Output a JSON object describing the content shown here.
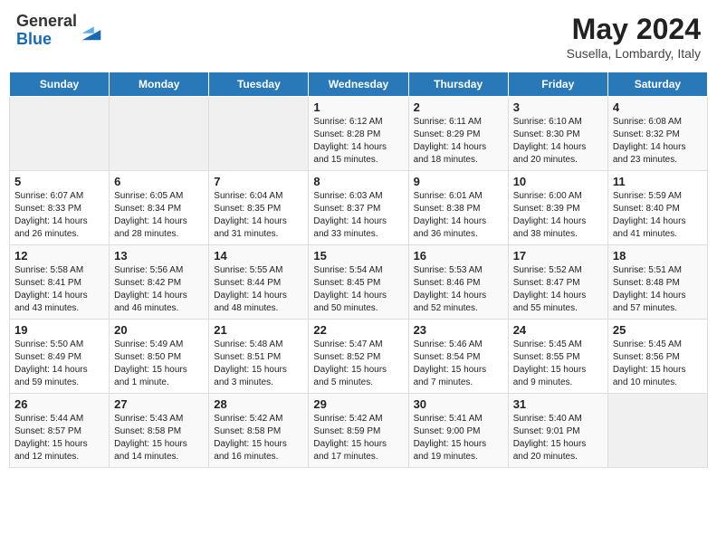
{
  "header": {
    "logo_line1": "General",
    "logo_line2": "Blue",
    "month": "May 2024",
    "location": "Susella, Lombardy, Italy"
  },
  "days_of_week": [
    "Sunday",
    "Monday",
    "Tuesday",
    "Wednesday",
    "Thursday",
    "Friday",
    "Saturday"
  ],
  "weeks": [
    [
      {
        "day": "",
        "info": ""
      },
      {
        "day": "",
        "info": ""
      },
      {
        "day": "",
        "info": ""
      },
      {
        "day": "1",
        "info": "Sunrise: 6:12 AM\nSunset: 8:28 PM\nDaylight: 14 hours\nand 15 minutes."
      },
      {
        "day": "2",
        "info": "Sunrise: 6:11 AM\nSunset: 8:29 PM\nDaylight: 14 hours\nand 18 minutes."
      },
      {
        "day": "3",
        "info": "Sunrise: 6:10 AM\nSunset: 8:30 PM\nDaylight: 14 hours\nand 20 minutes."
      },
      {
        "day": "4",
        "info": "Sunrise: 6:08 AM\nSunset: 8:32 PM\nDaylight: 14 hours\nand 23 minutes."
      }
    ],
    [
      {
        "day": "5",
        "info": "Sunrise: 6:07 AM\nSunset: 8:33 PM\nDaylight: 14 hours\nand 26 minutes."
      },
      {
        "day": "6",
        "info": "Sunrise: 6:05 AM\nSunset: 8:34 PM\nDaylight: 14 hours\nand 28 minutes."
      },
      {
        "day": "7",
        "info": "Sunrise: 6:04 AM\nSunset: 8:35 PM\nDaylight: 14 hours\nand 31 minutes."
      },
      {
        "day": "8",
        "info": "Sunrise: 6:03 AM\nSunset: 8:37 PM\nDaylight: 14 hours\nand 33 minutes."
      },
      {
        "day": "9",
        "info": "Sunrise: 6:01 AM\nSunset: 8:38 PM\nDaylight: 14 hours\nand 36 minutes."
      },
      {
        "day": "10",
        "info": "Sunrise: 6:00 AM\nSunset: 8:39 PM\nDaylight: 14 hours\nand 38 minutes."
      },
      {
        "day": "11",
        "info": "Sunrise: 5:59 AM\nSunset: 8:40 PM\nDaylight: 14 hours\nand 41 minutes."
      }
    ],
    [
      {
        "day": "12",
        "info": "Sunrise: 5:58 AM\nSunset: 8:41 PM\nDaylight: 14 hours\nand 43 minutes."
      },
      {
        "day": "13",
        "info": "Sunrise: 5:56 AM\nSunset: 8:42 PM\nDaylight: 14 hours\nand 46 minutes."
      },
      {
        "day": "14",
        "info": "Sunrise: 5:55 AM\nSunset: 8:44 PM\nDaylight: 14 hours\nand 48 minutes."
      },
      {
        "day": "15",
        "info": "Sunrise: 5:54 AM\nSunset: 8:45 PM\nDaylight: 14 hours\nand 50 minutes."
      },
      {
        "day": "16",
        "info": "Sunrise: 5:53 AM\nSunset: 8:46 PM\nDaylight: 14 hours\nand 52 minutes."
      },
      {
        "day": "17",
        "info": "Sunrise: 5:52 AM\nSunset: 8:47 PM\nDaylight: 14 hours\nand 55 minutes."
      },
      {
        "day": "18",
        "info": "Sunrise: 5:51 AM\nSunset: 8:48 PM\nDaylight: 14 hours\nand 57 minutes."
      }
    ],
    [
      {
        "day": "19",
        "info": "Sunrise: 5:50 AM\nSunset: 8:49 PM\nDaylight: 14 hours\nand 59 minutes."
      },
      {
        "day": "20",
        "info": "Sunrise: 5:49 AM\nSunset: 8:50 PM\nDaylight: 15 hours\nand 1 minute."
      },
      {
        "day": "21",
        "info": "Sunrise: 5:48 AM\nSunset: 8:51 PM\nDaylight: 15 hours\nand 3 minutes."
      },
      {
        "day": "22",
        "info": "Sunrise: 5:47 AM\nSunset: 8:52 PM\nDaylight: 15 hours\nand 5 minutes."
      },
      {
        "day": "23",
        "info": "Sunrise: 5:46 AM\nSunset: 8:54 PM\nDaylight: 15 hours\nand 7 minutes."
      },
      {
        "day": "24",
        "info": "Sunrise: 5:45 AM\nSunset: 8:55 PM\nDaylight: 15 hours\nand 9 minutes."
      },
      {
        "day": "25",
        "info": "Sunrise: 5:45 AM\nSunset: 8:56 PM\nDaylight: 15 hours\nand 10 minutes."
      }
    ],
    [
      {
        "day": "26",
        "info": "Sunrise: 5:44 AM\nSunset: 8:57 PM\nDaylight: 15 hours\nand 12 minutes."
      },
      {
        "day": "27",
        "info": "Sunrise: 5:43 AM\nSunset: 8:58 PM\nDaylight: 15 hours\nand 14 minutes."
      },
      {
        "day": "28",
        "info": "Sunrise: 5:42 AM\nSunset: 8:58 PM\nDaylight: 15 hours\nand 16 minutes."
      },
      {
        "day": "29",
        "info": "Sunrise: 5:42 AM\nSunset: 8:59 PM\nDaylight: 15 hours\nand 17 minutes."
      },
      {
        "day": "30",
        "info": "Sunrise: 5:41 AM\nSunset: 9:00 PM\nDaylight: 15 hours\nand 19 minutes."
      },
      {
        "day": "31",
        "info": "Sunrise: 5:40 AM\nSunset: 9:01 PM\nDaylight: 15 hours\nand 20 minutes."
      },
      {
        "day": "",
        "info": ""
      }
    ]
  ]
}
